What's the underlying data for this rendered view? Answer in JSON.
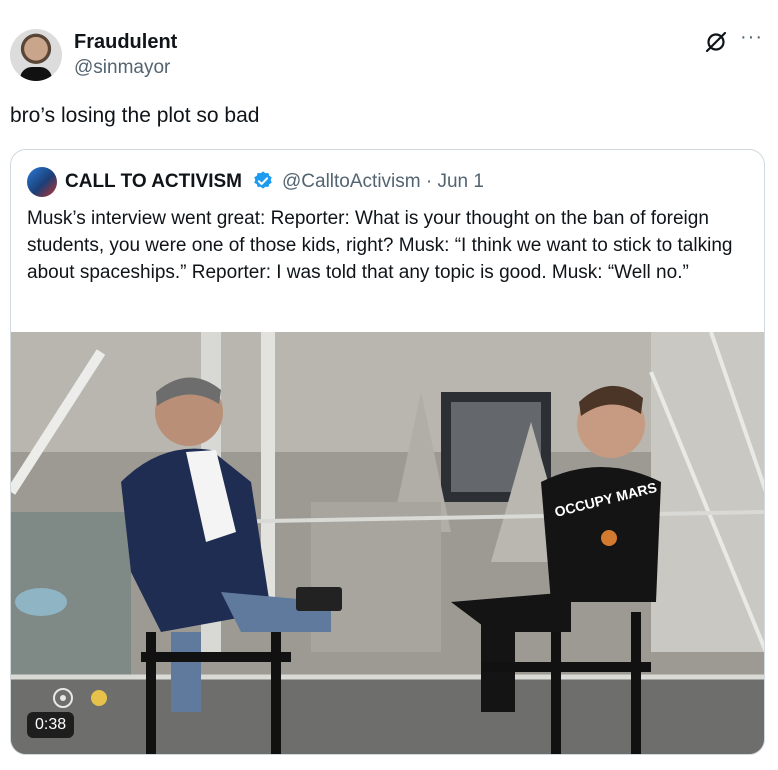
{
  "post": {
    "author_name": "Fraudulent",
    "author_handle": "@sinmayor",
    "text": "bro’s losing the plot so bad",
    "icons": {
      "grok": "grok-icon",
      "more": "more-options-icon"
    },
    "more_glyph": "···"
  },
  "quote": {
    "author_name": "CALL TO ACTIVISM",
    "author_handle": "@CalltoActivism · Jun 1",
    "verified_color": "#1d9bf0",
    "text": "Musk’s interview went great: Reporter: What is your thought on the ban of foreign students, you were one of those kids, right? Musk: “I think we want to stick to talking about spaceships.” Reporter: I was told that any topic is good. Musk: “Well no.”",
    "media": {
      "duration": "0:38",
      "shirt_text": "OCCUPY MARS"
    }
  }
}
